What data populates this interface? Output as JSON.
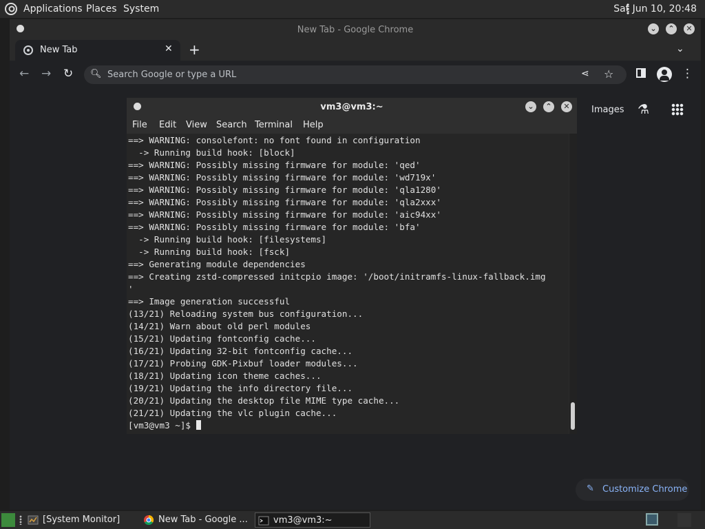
{
  "top_panel": {
    "menus": [
      "Applications",
      "Places",
      "System"
    ],
    "clock": "Sat Jun 10, 20:48"
  },
  "chrome": {
    "window_title": "New Tab - Google Chrome",
    "tab_title": "New Tab",
    "omnibox_placeholder": "Search Google or type a URL",
    "images_link": "Images",
    "customize_label": "Customize Chrome"
  },
  "terminal": {
    "title": "vm3@vm3:~",
    "menu": [
      "File",
      "Edit",
      "View",
      "Search",
      "Terminal",
      "Help"
    ],
    "lines": [
      "==> WARNING: consolefont: no font found in configuration",
      "  -> Running build hook: [block]",
      "==> WARNING: Possibly missing firmware for module: 'qed'",
      "==> WARNING: Possibly missing firmware for module: 'wd719x'",
      "==> WARNING: Possibly missing firmware for module: 'qla1280'",
      "==> WARNING: Possibly missing firmware for module: 'qla2xxx'",
      "==> WARNING: Possibly missing firmware for module: 'aic94xx'",
      "==> WARNING: Possibly missing firmware for module: 'bfa'",
      "  -> Running build hook: [filesystems]",
      "  -> Running build hook: [fsck]",
      "==> Generating module dependencies",
      "==> Creating zstd-compressed initcpio image: '/boot/initramfs-linux-fallback.img",
      "'",
      "==> Image generation successful",
      "(13/21) Reloading system bus configuration...",
      "(14/21) Warn about old perl modules",
      "(15/21) Updating fontconfig cache...",
      "(16/21) Updating 32-bit fontconfig cache...",
      "(17/21) Probing GDK-Pixbuf loader modules...",
      "(18/21) Updating icon theme caches...",
      "(19/21) Updating the info directory file...",
      "(20/21) Updating the desktop file MIME type cache...",
      "(21/21) Updating the vlc plugin cache..."
    ],
    "prompt": "[vm3@vm3 ~]$ "
  },
  "taskbar": {
    "tasks": [
      {
        "label": "[System Monitor]",
        "icon": "system-monitor-icon"
      },
      {
        "label": "New Tab - Google ...",
        "icon": "chrome-icon"
      },
      {
        "label": "vm3@vm3:~",
        "icon": "terminal-icon"
      }
    ]
  }
}
